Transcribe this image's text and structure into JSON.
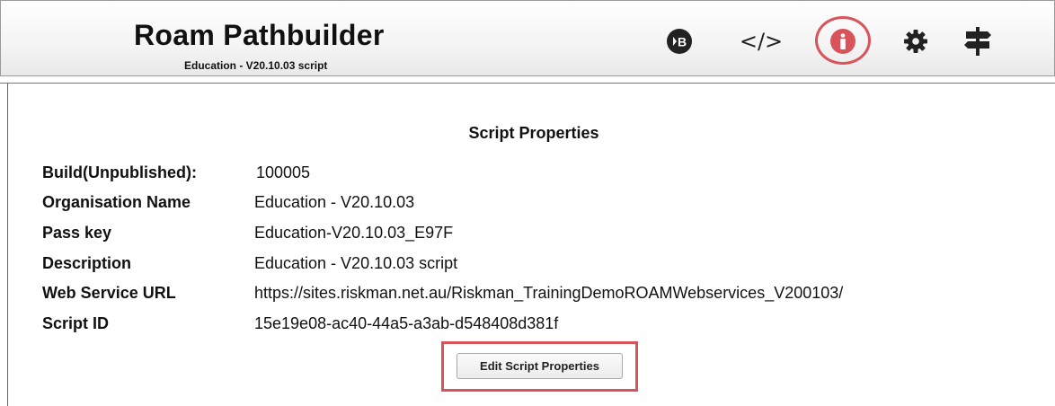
{
  "header": {
    "title": "Roam Pathbuilder",
    "subtitle": "Education - V20.10.03 script",
    "toolbar": [
      {
        "name": "build-play-icon",
        "glyph": "B"
      },
      {
        "name": "code-icon",
        "glyph": "</>"
      },
      {
        "name": "info-icon",
        "glyph": "i"
      },
      {
        "name": "gear-icon"
      },
      {
        "name": "signpost-icon"
      }
    ]
  },
  "main": {
    "section_title": "Script Properties",
    "properties": [
      {
        "label": "Build(Unpublished):",
        "value": "100005"
      },
      {
        "label": "Organisation Name",
        "value": "Education - V20.10.03"
      },
      {
        "label": "Pass key",
        "value": "Education-V20.10.03_E97F"
      },
      {
        "label": "Description",
        "value": "Education - V20.10.03 script"
      },
      {
        "label": "Web Service URL",
        "value": "https://sites.riskman.net.au/Riskman_TrainingDemoROAMWebservices_V200103/"
      },
      {
        "label": "Script ID",
        "value": "15e19e08-ac40-44a5-a3ab-d548408d381f"
      }
    ],
    "edit_button_label": "Edit Script Properties"
  },
  "colors": {
    "highlight": "#d9545a",
    "info_icon": "#d9545a",
    "icon_dark": "#222222"
  }
}
